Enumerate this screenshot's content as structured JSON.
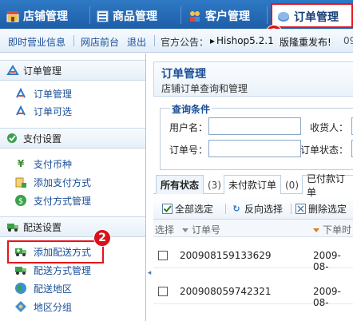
{
  "topnav": {
    "tabs": [
      {
        "label": "店铺管理",
        "icon": "store-icon"
      },
      {
        "label": "商品管理",
        "icon": "product-list-icon"
      },
      {
        "label": "客户管理",
        "icon": "customers-icon"
      },
      {
        "label": "订单管理",
        "icon": "order-icon"
      }
    ],
    "badge_1": "1"
  },
  "subbar": {
    "link_1": "即时营业信息",
    "link_2": "网店前台",
    "link_3": "退出",
    "notice_label": "官方公告：",
    "notice_text": "Hishop5.2.1",
    "notice_text_2": "版隆重发布!",
    "notice_tail": "09"
  },
  "sidebar": {
    "sections": [
      {
        "title": "订单管理",
        "items": [
          "订单管理",
          "订单可选"
        ]
      },
      {
        "title": "支付设置",
        "items": [
          "支付币种",
          "添加支付方式",
          "支付方式管理"
        ]
      },
      {
        "title": "配送设置",
        "items": [
          "添加配送方式",
          "配送方式管理",
          "配送地区",
          "地区分组"
        ]
      }
    ],
    "badge_2": "2"
  },
  "main": {
    "title": "订单管理",
    "subtitle": "店铺订单查询和管理",
    "query": {
      "legend": "查询条件",
      "username_label": "用户名：",
      "consignee_label": "收货人：",
      "order_no_label": "订单号：",
      "order_status_label": "订单状态："
    },
    "tabs": [
      {
        "label": "所有状态",
        "count": "(3)"
      },
      {
        "label": "未付款订单",
        "count": "(0)"
      },
      {
        "label": "已付款订单",
        "count": ""
      }
    ],
    "toolbar": {
      "select_all": "全部选定",
      "invert": "反向选择",
      "delete": "删除选定"
    },
    "table": {
      "headers": [
        "选择",
        "订单号",
        "下单时"
      ],
      "rows": [
        {
          "order_no": "200908159133629",
          "date": "2009-08-"
        },
        {
          "order_no": "200908059742321",
          "date": "2009-08-"
        }
      ]
    }
  },
  "colors": {
    "nav_blue": "#1e5da8",
    "link_blue": "#1a4f98",
    "highlight_red": "#e8141c"
  }
}
